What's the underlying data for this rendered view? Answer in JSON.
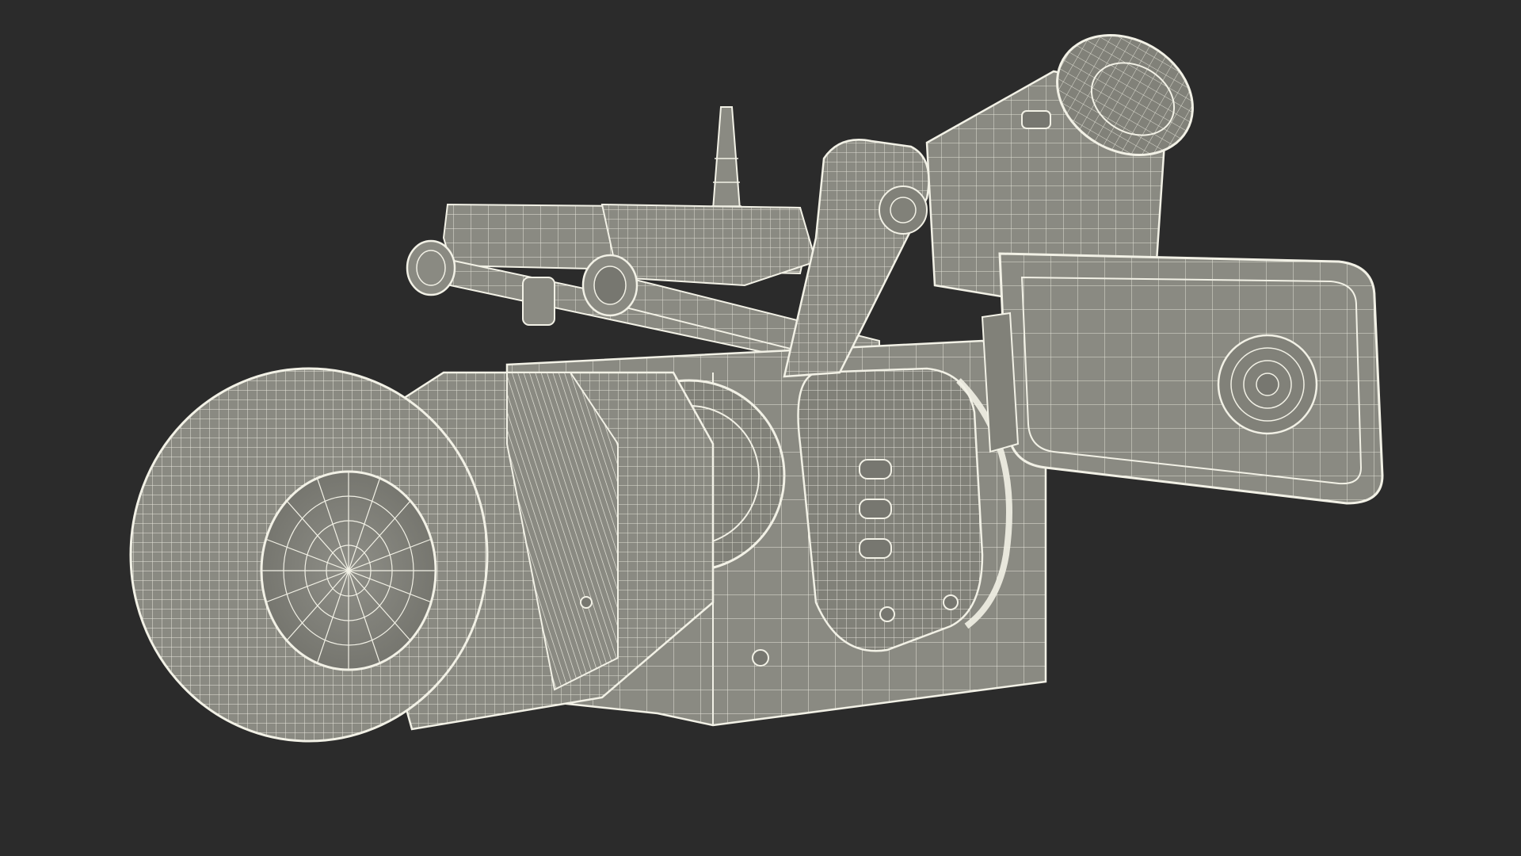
{
  "scene": {
    "subject": "cinema-camera-wireframe-render",
    "colors": {
      "background": "#2b2b2b",
      "fill": "#8a8a82",
      "fill_dark": "#6f6f69",
      "fill_light": "#9a9a92",
      "wire": "#f2f1e6"
    }
  }
}
